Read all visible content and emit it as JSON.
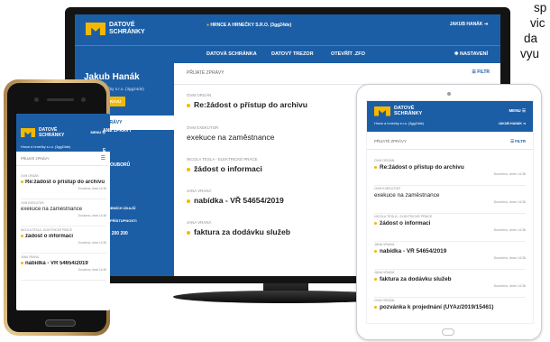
{
  "side_text": [
    "sp",
    "vic",
    "da",
    "vyu"
  ],
  "brand": {
    "line1": "DATOVÉ",
    "line2": "SCHRÁNKY"
  },
  "monitor": {
    "company": "HRNCE A HRNEČKY S.R.O. (3gg24de)",
    "user_top": "JAKUB HANÁK",
    "nav": [
      "DATOVÁ SCHRÁNKA",
      "DATOVÝ TREZOR",
      "OTEVŘÍT .ZFO"
    ],
    "settings": "NASTAVENÍ",
    "user_name": "Jakub Hanák",
    "firm": "Hrnce a hrnečky s.r.o. (3gg24de)",
    "new_button": "NAPSAT ZPRÁVU",
    "side_nav": [
      "PŘIJATÉ ZPRÁVY"
    ],
    "list_title": "PŘIJATÉ ZPRÁVY",
    "filter": "FILTR",
    "messages": [
      {
        "sender": "OVM ORGÁN",
        "subject": "Re:žádost o přístup do archivu",
        "date": "Doručeno, dnes 14:36",
        "unread": true
      },
      {
        "sender": "OVM EXEKUTOR",
        "subject": "exekuce na zaměstnance",
        "date": "",
        "unread": false
      },
      {
        "sender": "NICOLA TESLA - ELEKTRICKÉ PRÁCE",
        "subject": "žádost o informaci",
        "date": "",
        "unread": true
      },
      {
        "sender": "JANA VRANÁ",
        "subject": "nabídka - VŘ 54654/2019",
        "date": "",
        "unread": true
      },
      {
        "sender": "JANA VRANÁ",
        "subject": "faktura za dodávku služeb",
        "date": "",
        "unread": true
      }
    ]
  },
  "phone": {
    "menu": "MENU",
    "firm": "Hrnce a hrnečky s.r.o. (3gg24de)",
    "list_title": "PŘIJATÉ ZPRÁVY",
    "peek": [
      "ANÉ ZPRÁVY",
      "E",
      "É SOUBORŮ",
      "OSOBNÍCH ÚDAJŮ",
      "U K PŘÍSTUPNOSTI",
      "954 200 200"
    ],
    "messages": [
      {
        "sender": "OVM ORGÁN",
        "subject": "Re:žádost o přístup do archivu",
        "date": "Doručeno, dnes 14:36",
        "unread": true
      },
      {
        "sender": "OVM EXEKUTOR",
        "subject": "exekuce na zaměstnance",
        "date": "Doručeno, dnes 14:36",
        "unread": false
      },
      {
        "sender": "NICOLA TESLA - ELEKTRICKÉ PRÁCE",
        "subject": "žádost o informaci",
        "date": "Doručeno, dnes 14:36",
        "unread": true
      },
      {
        "sender": "JANA VRANÁ",
        "subject": "nabídka - VŘ 54654/2019",
        "date": "Doručeno, dnes 14:36",
        "unread": true
      }
    ]
  },
  "tablet": {
    "menu": "MENU",
    "firm": "Hrnce a hrnečky s.r.o. (3gg24de)",
    "user": "JAKUB HANÁK",
    "list_title": "PŘIJATÉ ZPRÁVY",
    "filter": "FILTR",
    "messages": [
      {
        "sender": "OVM ORGÁN",
        "subject": "Re:žádost o přístup do archivu",
        "date": "Doručeno, dnes 14:36",
        "unread": true
      },
      {
        "sender": "OVM EXEKUTOR",
        "subject": "exekuce na zaměstnance",
        "date": "Doručeno, dnes 14:36",
        "unread": false
      },
      {
        "sender": "NICOLA TESLA - ELEKTRICKÉ PRÁCE",
        "subject": "žádost o informaci",
        "date": "Doručeno, dnes 14:36",
        "unread": true
      },
      {
        "sender": "JANA VRANÁ",
        "subject": "nabídka - VŘ 54654/2019",
        "date": "Doručeno, dnes 14:36",
        "unread": true
      },
      {
        "sender": "JANA VRANÁ",
        "subject": "faktura za dodávku služeb",
        "date": "Doručeno, dnes 14:36",
        "unread": true
      },
      {
        "sender": "OVM ORGÁN",
        "subject": "pozvánka k projednání (UYAz/2019/15461)",
        "date": "",
        "unread": true
      }
    ]
  },
  "colors": {
    "primary": "#1c5ea6",
    "accent": "#f5b800"
  }
}
